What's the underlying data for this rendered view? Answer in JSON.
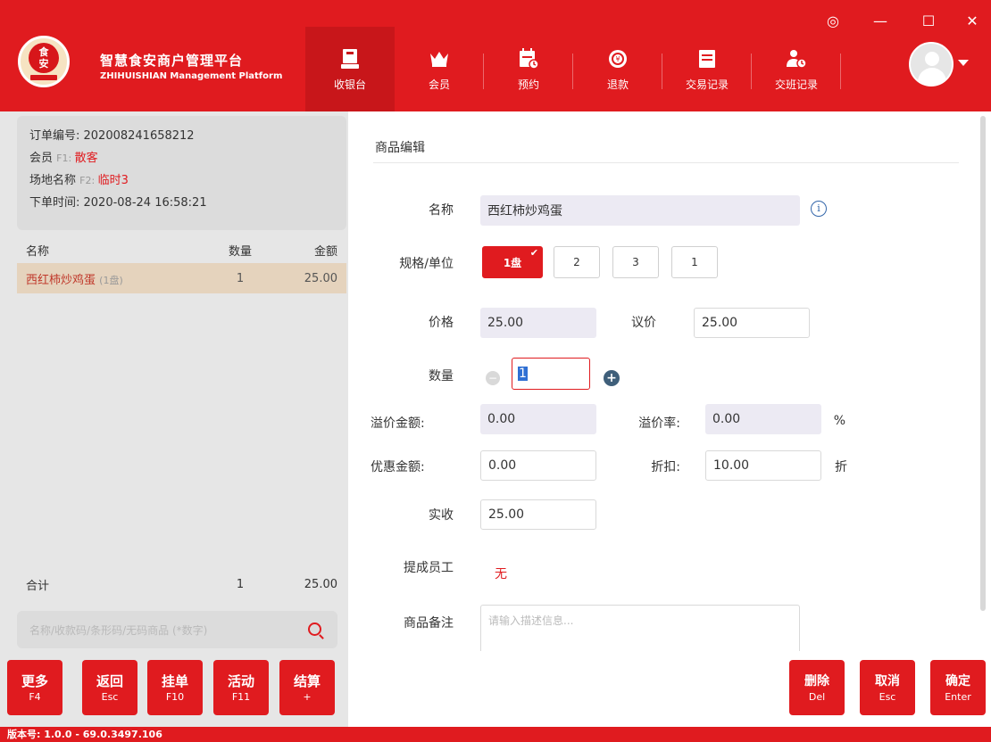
{
  "app": {
    "brand_cn": "智慧食安商户管理平台",
    "brand_en": "ZHIHUISHIAN Management Platform",
    "logo_text": "食安",
    "accent": "#e01b1f"
  },
  "window": {
    "settings_icon": "◎",
    "minimize": "—",
    "maximize": "☐",
    "close": "✕"
  },
  "nav": [
    {
      "label": "收银台",
      "icon": "cashier-icon",
      "active": true
    },
    {
      "label": "会员",
      "icon": "crown-icon",
      "active": false
    },
    {
      "label": "预约",
      "icon": "calendar-icon",
      "active": false
    },
    {
      "label": "退款",
      "icon": "refund-icon",
      "active": false
    },
    {
      "label": "交易记录",
      "icon": "records-icon",
      "active": false
    },
    {
      "label": "交班记录",
      "icon": "shift-icon",
      "active": false
    }
  ],
  "order": {
    "number_label": "订单编号: ",
    "number": "202008241658212",
    "member_label": "会员 ",
    "member_key": "F1: ",
    "member_value": "散客",
    "venue_label": "场地名称 ",
    "venue_key": "F2: ",
    "venue_value": "临时3",
    "time_label": "下单时间: ",
    "time": "2020-08-24 16:58:21"
  },
  "list": {
    "headers": {
      "name": "名称",
      "qty": "数量",
      "amount": "金额"
    },
    "rows": [
      {
        "name": "西红柿炒鸡蛋",
        "unit": "(1盘)",
        "qty": "1",
        "amount": "25.00"
      }
    ],
    "total_label": "合计",
    "total_qty": "1",
    "total_amount": "25.00"
  },
  "search": {
    "placeholder": "名称/收款码/条形码/无码商品 (*数字)"
  },
  "left_buttons": [
    {
      "label": "更多",
      "key": "F4"
    },
    {
      "label": "返回",
      "key": "Esc"
    },
    {
      "label": "挂单",
      "key": "F10"
    },
    {
      "label": "活动",
      "key": "F11"
    },
    {
      "label": "结算",
      "key": "+"
    }
  ],
  "editor": {
    "title": "商品编辑",
    "name_label": "名称",
    "name_value": "西红柿炒鸡蛋",
    "spec_label": "规格/单位",
    "specs": [
      "1盘",
      "2",
      "3",
      "1"
    ],
    "price_label": "价格",
    "price_value": "25.00",
    "negotiated_label": "议价",
    "negotiated_value": "25.00",
    "qty_label": "数量",
    "qty_value": "1",
    "premium_amount_label": "溢价金额:",
    "premium_amount_value": "0.00",
    "premium_rate_label": "溢价率:",
    "premium_rate_value": "0.00",
    "premium_rate_unit": "%",
    "discount_amount_label": "优惠金额:",
    "discount_amount_value": "0.00",
    "discount_label": "折扣:",
    "discount_value": "10.00",
    "discount_unit": "折",
    "received_label": "实收",
    "received_value": "25.00",
    "staff_label": "提成员工",
    "staff_value": "无",
    "remark_label": "商品备注",
    "remark_placeholder": "请输入描述信息..."
  },
  "right_buttons": [
    {
      "label": "删除",
      "key": "Del"
    },
    {
      "label": "取消",
      "key": "Esc"
    },
    {
      "label": "确定",
      "key": "Enter"
    }
  ],
  "footer": {
    "version": "版本号: 1.0.0 - 69.0.3497.106"
  }
}
